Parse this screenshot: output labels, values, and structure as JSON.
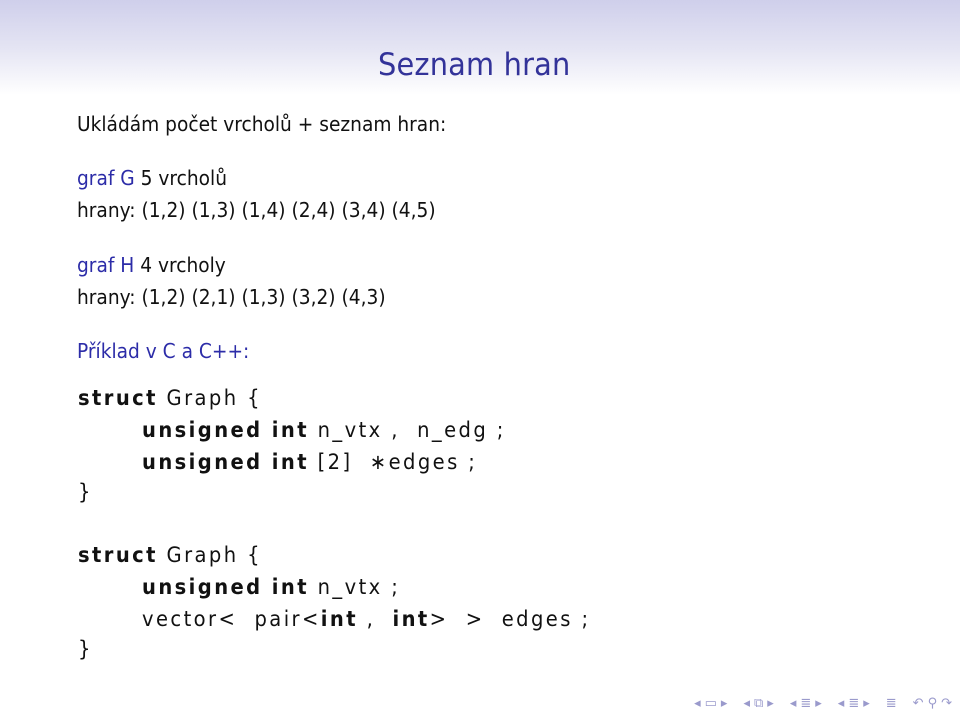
{
  "slide": {
    "title": "Seznam hran",
    "intro": "Ukládám počet vrcholů + seznam hran:",
    "graph_g": {
      "label": "graf G",
      "count": " 5 vrcholů",
      "edges": "hrany: (1,2) (1,3) (1,4) (2,4) (3,4) (4,5)"
    },
    "graph_h": {
      "label": "graf H",
      "count": " 4 vrcholy",
      "edges": "hrany: (1,2) (2,1) (1,3) (3,2) (4,3)"
    },
    "example_heading": "Příklad v C a C++:",
    "code_c": {
      "kw_struct": "struct",
      "name": " Graph {",
      "line1_kw": "unsigned int",
      "line1_rest": " n_vtx ,  n_edg ;",
      "line2_kw": "unsigned int",
      "line2_rest": " [2]  ∗edges ;",
      "close": "}"
    },
    "code_cpp": {
      "kw_struct": "struct",
      "name": " Graph {",
      "line1_kw": "unsigned int",
      "line1_rest": " n_vtx ;",
      "line2_a": "vector<  pair<",
      "line2_kw1": "int",
      "line2_b": " ,  ",
      "line2_kw2": "int",
      "line2_c": ">  >  edges ;",
      "close": "}"
    }
  },
  "navigation": {
    "icons": [
      "nav-frame-prev",
      "frame-icon",
      "nav-frame-next",
      "nav-subsection-prev",
      "subsection-icon",
      "nav-subsection-next",
      "nav-section-prev",
      "section-icon",
      "nav-section-next",
      "nav-doc-prev",
      "doc-icon",
      "nav-doc-next",
      "appendix-icon",
      "back-icon",
      "search-icon",
      "forward-icon"
    ],
    "color": "#9a9acc"
  }
}
